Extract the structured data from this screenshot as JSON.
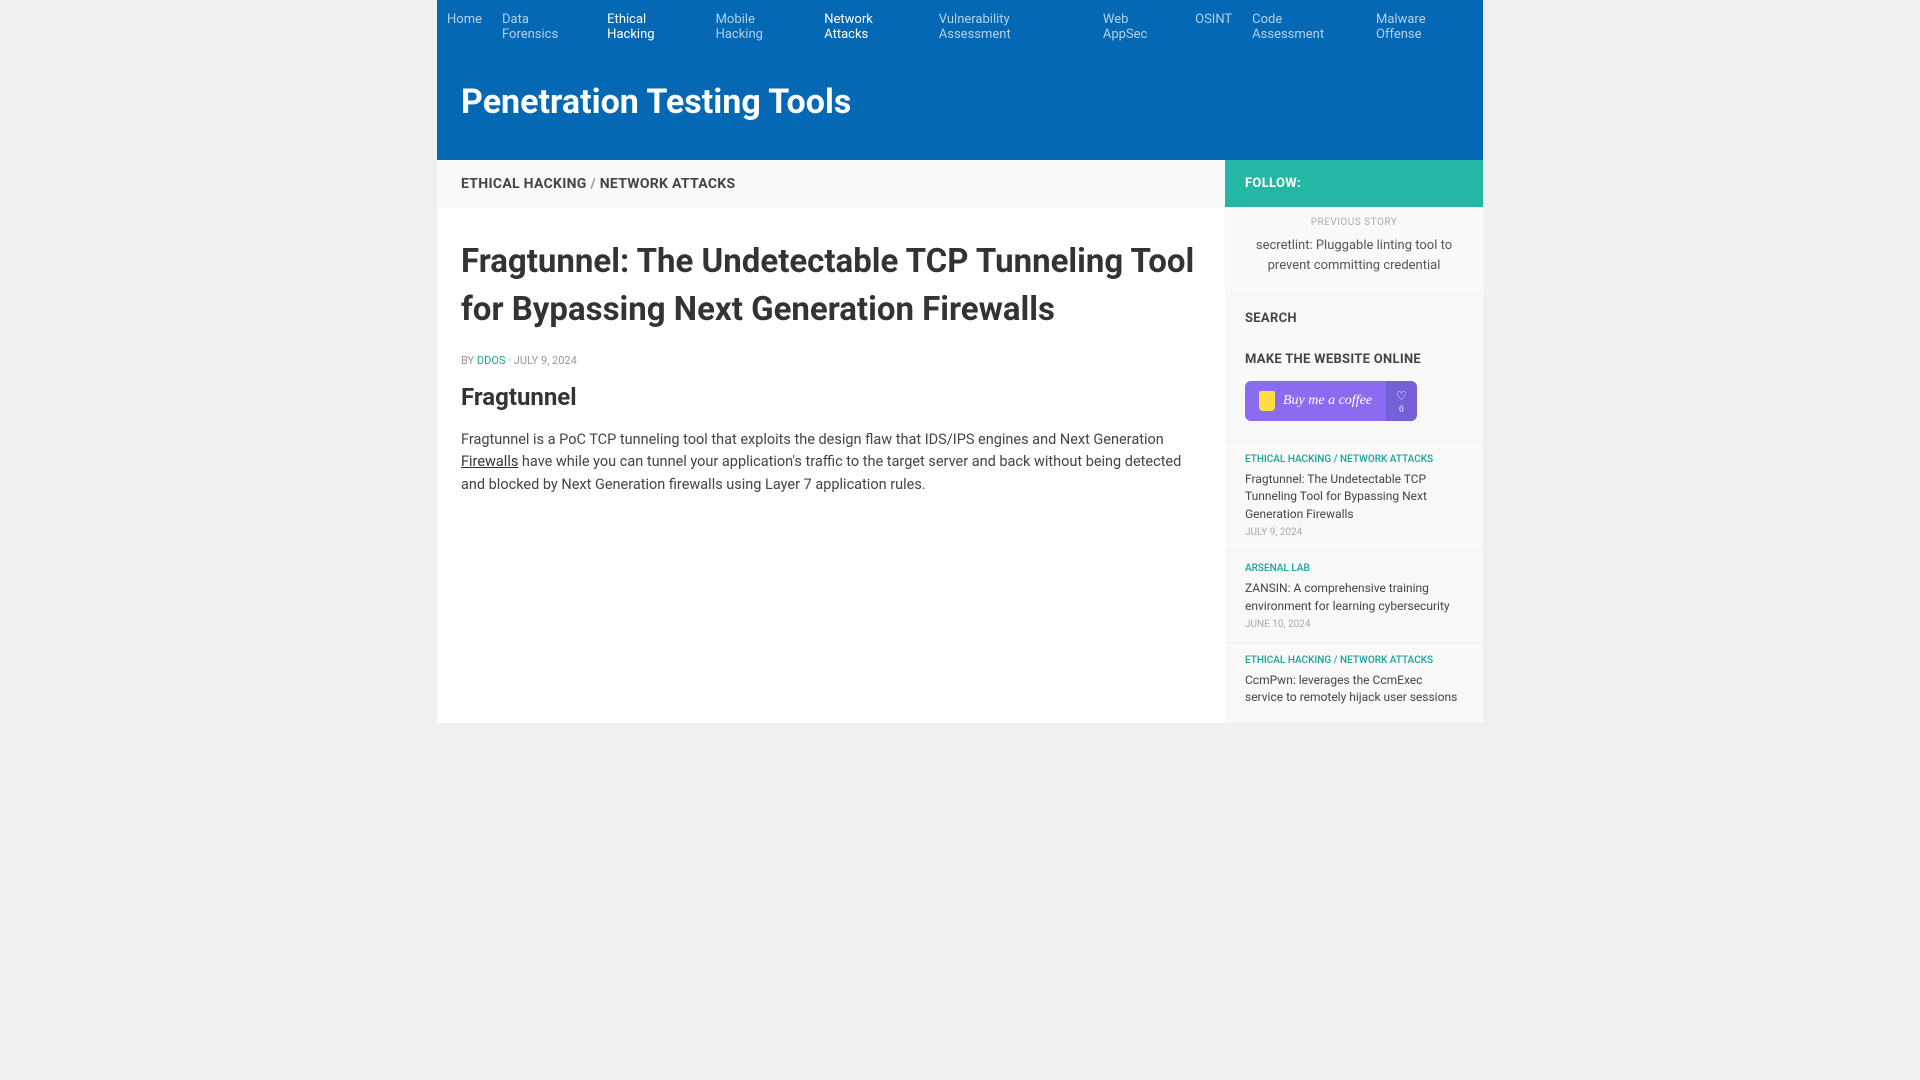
{
  "nav": {
    "items": [
      {
        "label": "Home",
        "active": false
      },
      {
        "label": "Data Forensics",
        "active": false
      },
      {
        "label": "Ethical Hacking",
        "active": true
      },
      {
        "label": "Mobile Hacking",
        "active": false
      },
      {
        "label": "Network Attacks",
        "active": true
      },
      {
        "label": "Vulnerability Assessment",
        "active": false
      },
      {
        "label": "Web AppSec",
        "active": false
      },
      {
        "label": "OSINT",
        "active": false
      },
      {
        "label": "Code Assessment",
        "active": false
      },
      {
        "label": "Malware Offense",
        "active": false
      }
    ]
  },
  "hero": {
    "title": "Penetration Testing Tools"
  },
  "article": {
    "category1": "ETHICAL HACKING",
    "sep": "/",
    "category2": "NETWORK ATTACKS",
    "title": "Fragtunnel: The Undetectable TCP Tunneling Tool for Bypassing Next Generation Firewalls",
    "by": "BY",
    "author": "DDOS",
    "dot": "·",
    "date": "JULY 9, 2024",
    "heading": "Fragtunnel",
    "body_pre": "Fragtunnel is a PoC TCP tunneling tool that exploits the design flaw that IDS/IPS engines and Next Generation ",
    "body_link": "Firewalls",
    "body_post": " have while you can tunnel your application's traffic to the target server and back without being detected and blocked by Next Generation firewalls using Layer 7 application rules."
  },
  "sidebar": {
    "follow": "FOLLOW:",
    "prev_label": "PREVIOUS STORY",
    "prev_title": "secretlint: Pluggable linting tool to prevent committing credential",
    "search_heading": "SEARCH",
    "bmc_heading": "MAKE THE WEBSITE ONLINE",
    "bmc_label": "Buy me a coffee",
    "bmc_like_count": "0"
  },
  "related": [
    {
      "cats": "ETHICAL HACKING / NETWORK ATTACKS",
      "title": "Fragtunnel: The Undetectable TCP Tunneling Tool for Bypassing Next Generation Firewalls",
      "date": "JULY 9, 2024"
    },
    {
      "cats": "ARSENAL LAB",
      "title": "ZANSIN: A comprehensive training environment for learning cybersecurity",
      "date": "JUNE 10, 2024"
    },
    {
      "cats": "ETHICAL HACKING / NETWORK ATTACKS",
      "title": "CcmPwn: leverages the CcmExec service to remotely hijack user sessions",
      "date": ""
    }
  ]
}
